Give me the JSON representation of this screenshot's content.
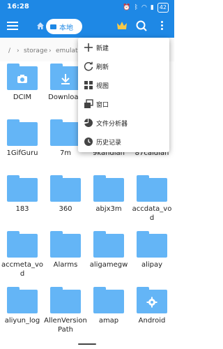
{
  "status_bar": {
    "time": "16:28",
    "battery": "42"
  },
  "app_bar": {
    "location_chip_label": "本地",
    "menu_icon": "hamburger-menu-icon",
    "home_icon": "home-icon",
    "premium_icon": "crown-icon",
    "search_icon": "search-icon",
    "more_icon": "more-vertical-icon"
  },
  "path_bar": {
    "root": "/",
    "seg1": "storage",
    "seg2": "emulated"
  },
  "dropdown_menu": {
    "items": [
      {
        "label": "新建",
        "icon": "plus-icon"
      },
      {
        "label": "刷新",
        "icon": "refresh-icon"
      },
      {
        "label": "视图",
        "icon": "grid-view-icon"
      },
      {
        "label": "窗口",
        "icon": "window-icon"
      },
      {
        "label": "文件分析器",
        "icon": "pie-chart-icon"
      },
      {
        "label": "历史记录",
        "icon": "history-clock-icon"
      }
    ]
  },
  "folders": [
    {
      "name": "DCIM",
      "badge": "camera-icon"
    },
    {
      "name": "Download",
      "badge": "download-icon"
    },
    {
      "name": "",
      "badge": ""
    },
    {
      "name": "",
      "badge": ""
    },
    {
      "name": "1GifGuru",
      "badge": ""
    },
    {
      "name": "7m",
      "badge": ""
    },
    {
      "name": "9kandian",
      "badge": ""
    },
    {
      "name": "87caidian",
      "badge": ""
    },
    {
      "name": "183",
      "badge": ""
    },
    {
      "name": "360",
      "badge": ""
    },
    {
      "name": "abjx3m",
      "badge": ""
    },
    {
      "name": "accdata_vod",
      "badge": ""
    },
    {
      "name": "accmeta_vod",
      "badge": ""
    },
    {
      "name": "Alarms",
      "badge": ""
    },
    {
      "name": "aligamegw",
      "badge": ""
    },
    {
      "name": "alipay",
      "badge": ""
    },
    {
      "name": "aliyun_log",
      "badge": ""
    },
    {
      "name": "AllenVersionPath",
      "badge": ""
    },
    {
      "name": "amap",
      "badge": ""
    },
    {
      "name": "Android",
      "badge": "settings-gear-icon"
    }
  ],
  "colors": {
    "primary": "#1e88e5",
    "folder": "#64b5f6"
  }
}
